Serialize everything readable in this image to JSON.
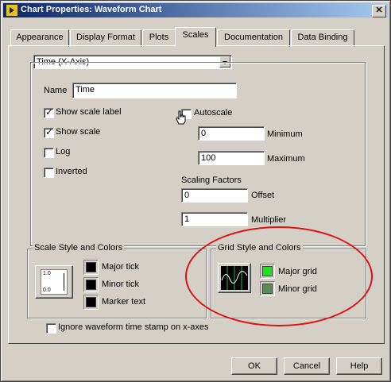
{
  "window": {
    "title": "Chart Properties: Waveform Chart",
    "close_label": "✕"
  },
  "tabs": [
    {
      "label": "Appearance"
    },
    {
      "label": "Display Format"
    },
    {
      "label": "Plots"
    },
    {
      "label": "Scales",
      "active": true
    },
    {
      "label": "Documentation"
    },
    {
      "label": "Data Binding"
    }
  ],
  "scale_select": {
    "value": "Time (X-Axis)"
  },
  "name": {
    "label": "Name",
    "value": "Time"
  },
  "checkboxes": {
    "show_scale_label": {
      "label": "Show scale label",
      "checked": true
    },
    "show_scale": {
      "label": "Show scale",
      "checked": true
    },
    "log": {
      "label": "Log",
      "checked": false
    },
    "inverted": {
      "label": "Inverted",
      "checked": false
    },
    "autoscale": {
      "label": "Autoscale",
      "checked": false
    }
  },
  "range": {
    "minimum_value": "0",
    "minimum_label": "Minimum",
    "maximum_value": "100",
    "maximum_label": "Maximum"
  },
  "scaling": {
    "title": "Scaling Factors",
    "offset_value": "0",
    "offset_label": "Offset",
    "multiplier_value": "1",
    "multiplier_label": "Multiplier"
  },
  "scale_style": {
    "title": "Scale Style and Colors",
    "preview_top": "1.0",
    "preview_bottom": "0.0",
    "major_tick": {
      "label": "Major tick",
      "color": "#000000"
    },
    "minor_tick": {
      "label": "Minor tick",
      "color": "#000000"
    },
    "marker_text": {
      "label": "Marker text",
      "color": "#000000"
    }
  },
  "grid_style": {
    "title": "Grid Style and Colors",
    "major_grid": {
      "label": "Major grid",
      "color": "#22e022"
    },
    "minor_grid": {
      "label": "Minor grid",
      "color": "#5a8a5a"
    }
  },
  "ignore_timestamp": {
    "label": "Ignore waveform time stamp on x-axes",
    "checked": false
  },
  "buttons": {
    "ok": "OK",
    "cancel": "Cancel",
    "help": "Help"
  },
  "colors": {
    "annotation": "#e01010",
    "face": "#d4d0c8",
    "title_start": "#0a246a"
  }
}
